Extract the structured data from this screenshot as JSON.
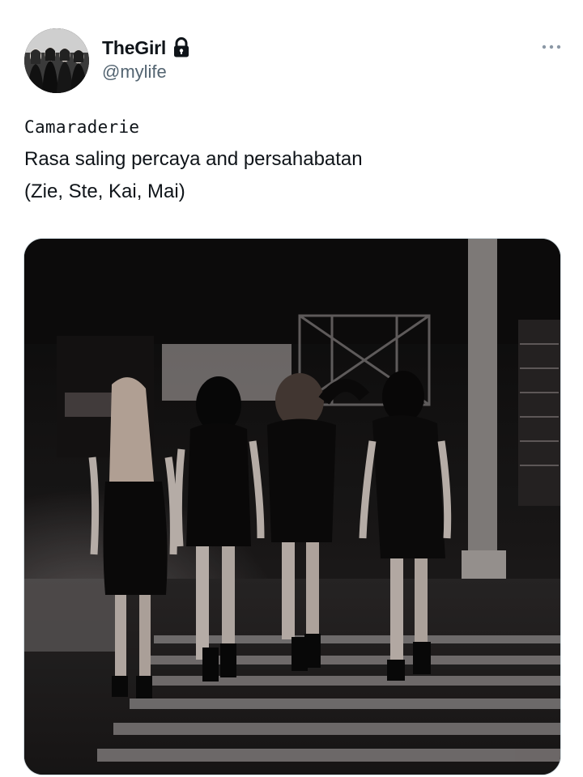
{
  "tweet": {
    "display_name": "TheGirl",
    "handle": "@mylife",
    "text_lines": [
      "Camaraderie",
      "Rasa saling percaya and persahabatan",
      "(Zie, Ste, Kai, Mai)"
    ]
  },
  "icons": {
    "lock": "lock-icon",
    "more": "more-horizontal-icon"
  },
  "colors": {
    "text_primary": "#0f1419",
    "text_secondary": "#536471",
    "media_border": "#cfd9de"
  }
}
